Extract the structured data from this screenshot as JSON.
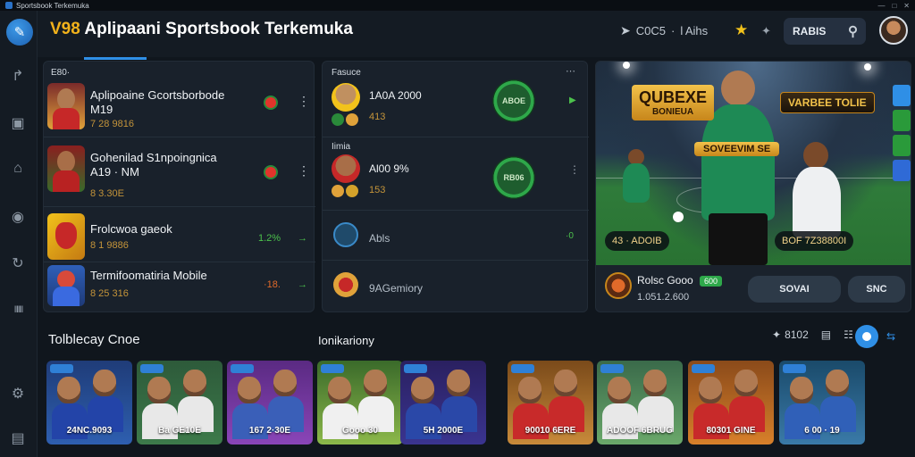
{
  "window": {
    "tab_title": "Sportsbook Terkemuka",
    "controls": [
      "—",
      "□",
      "✕"
    ]
  },
  "header": {
    "brand": "V98",
    "title": "Aplipaani Sportsbook Terkemuka",
    "meta_label": "C0C5",
    "meta_sep": "·",
    "meta_value": "l Aihs",
    "button_label": "RABIS"
  },
  "sidebar": {
    "logo_glyph": "✎",
    "icons": [
      "↱",
      "▣",
      "⌂",
      "◉",
      "↻",
      "ⅡⅡⅡ",
      "⚙",
      "▤"
    ]
  },
  "panel1": {
    "header": "E80·",
    "items": [
      {
        "title": "Aplipoaine Gcortsborbode",
        "title2": "M19",
        "sub": "7 28 9816",
        "dot": "#e1342b"
      },
      {
        "title": "Gohenilad S1npoingnica",
        "title2": "A19 · NM",
        "sub": "8 3.30E",
        "dot": "#e1342b"
      },
      {
        "title": "Frolcwoa gaeok",
        "title2": "",
        "sub": "8 1 9886",
        "right": "1.2%"
      },
      {
        "title": "Termifoomatiria Mobile",
        "title2": "",
        "sub": "8 25 316",
        "right": "·18."
      }
    ]
  },
  "panel2": {
    "header1": "Fasuce",
    "header2": "Iimia",
    "items": [
      {
        "title": "1A0A 2000",
        "sub": "413",
        "emblem": "ABOE"
      },
      {
        "title": "Al00 9%",
        "sub": "153",
        "emblem": "RB06"
      },
      {
        "title": "Abls",
        "sub": "",
        "right": "·0"
      },
      {
        "title": "9AGemiory",
        "sub": ""
      }
    ]
  },
  "hero": {
    "banner_left": "QUBEXE",
    "banner_left_sub": "BONIEUA",
    "banner_right": "VARBEE TOLIE",
    "center_bar": "SOVEEVIM SE",
    "chip_left": "43 · ADOIB",
    "chip_right": "BOF 7Z38800I",
    "footer_title": "Rolsc Gooo",
    "footer_badge": "600",
    "footer_sub": "1.051.2.600",
    "button_primary": "SOVAI",
    "button_secondary": "SNC"
  },
  "section": {
    "title_left": "Tolblecay Cnoe",
    "title_right": "Ionikariony",
    "controls": {
      "count": "8102",
      "next": "⇆"
    }
  },
  "cards": [
    {
      "label": "24NC.9093",
      "bg1": "#1f3c78",
      "bg2": "#2e5fb0",
      "shirt": "#2344a8"
    },
    {
      "label": "Ba GE10E",
      "bg1": "#2d5a3a",
      "bg2": "#3d7a4a",
      "shirt": "#e8e8e8"
    },
    {
      "label": "167 2·30E",
      "bg1": "#5a2a82",
      "bg2": "#8a45b8",
      "shirt": "#3a5fb8"
    },
    {
      "label": "Gooo 30",
      "bg1": "#3a6a2a",
      "bg2": "#8cb84a",
      "shirt": "#f0f0f0"
    },
    {
      "label": "5H 2000E",
      "bg1": "#2a2060",
      "bg2": "#3a3490",
      "shirt": "#2a48a8"
    },
    {
      "label": "90010 6ERE",
      "bg1": "#7a4a1a",
      "bg2": "#c88a3a",
      "shirt": "#c82a2a"
    },
    {
      "label": "ADOOF 6BRUG",
      "bg1": "#3a6a4a",
      "bg2": "#6aa86a",
      "shirt": "#e8e8e8"
    },
    {
      "label": "80301 GINE",
      "bg1": "#8a4a1a",
      "bg2": "#d8802a",
      "shirt": "#c82a2a"
    },
    {
      "label": "6 00 · 19",
      "bg1": "#1a4a6a",
      "bg2": "#3a7aa8",
      "shirt": "#3060b8"
    }
  ],
  "colors": {
    "accent": "#2f8fe6",
    "brand_gold": "#f2b21b",
    "sub_amber": "#c4943a",
    "green": "#2ea84a"
  }
}
